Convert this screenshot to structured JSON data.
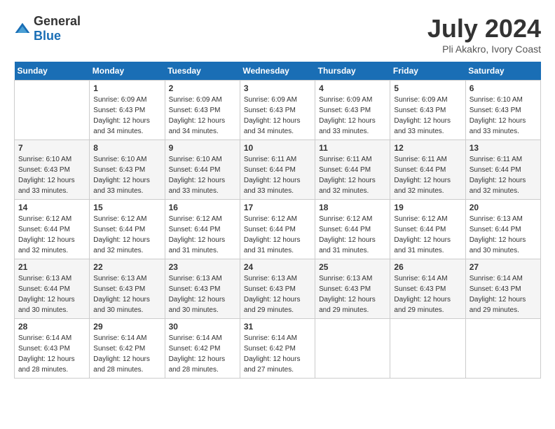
{
  "header": {
    "logo_general": "General",
    "logo_blue": "Blue",
    "month_title": "July 2024",
    "location": "Pli Akakro, Ivory Coast"
  },
  "days_of_week": [
    "Sunday",
    "Monday",
    "Tuesday",
    "Wednesday",
    "Thursday",
    "Friday",
    "Saturday"
  ],
  "weeks": [
    [
      {
        "day": "",
        "info": ""
      },
      {
        "day": "1",
        "info": "Sunrise: 6:09 AM\nSunset: 6:43 PM\nDaylight: 12 hours\nand 34 minutes."
      },
      {
        "day": "2",
        "info": "Sunrise: 6:09 AM\nSunset: 6:43 PM\nDaylight: 12 hours\nand 34 minutes."
      },
      {
        "day": "3",
        "info": "Sunrise: 6:09 AM\nSunset: 6:43 PM\nDaylight: 12 hours\nand 34 minutes."
      },
      {
        "day": "4",
        "info": "Sunrise: 6:09 AM\nSunset: 6:43 PM\nDaylight: 12 hours\nand 33 minutes."
      },
      {
        "day": "5",
        "info": "Sunrise: 6:09 AM\nSunset: 6:43 PM\nDaylight: 12 hours\nand 33 minutes."
      },
      {
        "day": "6",
        "info": "Sunrise: 6:10 AM\nSunset: 6:43 PM\nDaylight: 12 hours\nand 33 minutes."
      }
    ],
    [
      {
        "day": "7",
        "info": ""
      },
      {
        "day": "8",
        "info": "Sunrise: 6:10 AM\nSunset: 6:43 PM\nDaylight: 12 hours\nand 33 minutes."
      },
      {
        "day": "9",
        "info": "Sunrise: 6:10 AM\nSunset: 6:44 PM\nDaylight: 12 hours\nand 33 minutes."
      },
      {
        "day": "10",
        "info": "Sunrise: 6:11 AM\nSunset: 6:44 PM\nDaylight: 12 hours\nand 33 minutes."
      },
      {
        "day": "11",
        "info": "Sunrise: 6:11 AM\nSunset: 6:44 PM\nDaylight: 12 hours\nand 32 minutes."
      },
      {
        "day": "12",
        "info": "Sunrise: 6:11 AM\nSunset: 6:44 PM\nDaylight: 12 hours\nand 32 minutes."
      },
      {
        "day": "13",
        "info": "Sunrise: 6:11 AM\nSunset: 6:44 PM\nDaylight: 12 hours\nand 32 minutes."
      }
    ],
    [
      {
        "day": "14",
        "info": ""
      },
      {
        "day": "15",
        "info": "Sunrise: 6:12 AM\nSunset: 6:44 PM\nDaylight: 12 hours\nand 32 minutes."
      },
      {
        "day": "16",
        "info": "Sunrise: 6:12 AM\nSunset: 6:44 PM\nDaylight: 12 hours\nand 31 minutes."
      },
      {
        "day": "17",
        "info": "Sunrise: 6:12 AM\nSunset: 6:44 PM\nDaylight: 12 hours\nand 31 minutes."
      },
      {
        "day": "18",
        "info": "Sunrise: 6:12 AM\nSunset: 6:44 PM\nDaylight: 12 hours\nand 31 minutes."
      },
      {
        "day": "19",
        "info": "Sunrise: 6:12 AM\nSunset: 6:44 PM\nDaylight: 12 hours\nand 31 minutes."
      },
      {
        "day": "20",
        "info": "Sunrise: 6:13 AM\nSunset: 6:44 PM\nDaylight: 12 hours\nand 30 minutes."
      }
    ],
    [
      {
        "day": "21",
        "info": ""
      },
      {
        "day": "22",
        "info": "Sunrise: 6:13 AM\nSunset: 6:43 PM\nDaylight: 12 hours\nand 30 minutes."
      },
      {
        "day": "23",
        "info": "Sunrise: 6:13 AM\nSunset: 6:43 PM\nDaylight: 12 hours\nand 30 minutes."
      },
      {
        "day": "24",
        "info": "Sunrise: 6:13 AM\nSunset: 6:43 PM\nDaylight: 12 hours\nand 29 minutes."
      },
      {
        "day": "25",
        "info": "Sunrise: 6:13 AM\nSunset: 6:43 PM\nDaylight: 12 hours\nand 29 minutes."
      },
      {
        "day": "26",
        "info": "Sunrise: 6:14 AM\nSunset: 6:43 PM\nDaylight: 12 hours\nand 29 minutes."
      },
      {
        "day": "27",
        "info": "Sunrise: 6:14 AM\nSunset: 6:43 PM\nDaylight: 12 hours\nand 29 minutes."
      }
    ],
    [
      {
        "day": "28",
        "info": "Sunrise: 6:14 AM\nSunset: 6:43 PM\nDaylight: 12 hours\nand 28 minutes."
      },
      {
        "day": "29",
        "info": "Sunrise: 6:14 AM\nSunset: 6:42 PM\nDaylight: 12 hours\nand 28 minutes."
      },
      {
        "day": "30",
        "info": "Sunrise: 6:14 AM\nSunset: 6:42 PM\nDaylight: 12 hours\nand 28 minutes."
      },
      {
        "day": "31",
        "info": "Sunrise: 6:14 AM\nSunset: 6:42 PM\nDaylight: 12 hours\nand 27 minutes."
      },
      {
        "day": "",
        "info": ""
      },
      {
        "day": "",
        "info": ""
      },
      {
        "day": "",
        "info": ""
      }
    ]
  ],
  "week1_day7": {
    "sunrise": "Sunrise: 6:10 AM",
    "sunset": "Sunset: 6:43 PM",
    "daylight": "Daylight: 12 hours",
    "minutes": "and 33 minutes."
  },
  "week3_day14": {
    "sunrise": "Sunrise: 6:12 AM",
    "sunset": "Sunset: 6:44 PM",
    "daylight": "Daylight: 12 hours",
    "minutes": "and 32 minutes."
  },
  "week4_day21": {
    "sunrise": "Sunrise: 6:13 AM",
    "sunset": "Sunset: 6:44 PM",
    "daylight": "Daylight: 12 hours",
    "minutes": "and 30 minutes."
  }
}
